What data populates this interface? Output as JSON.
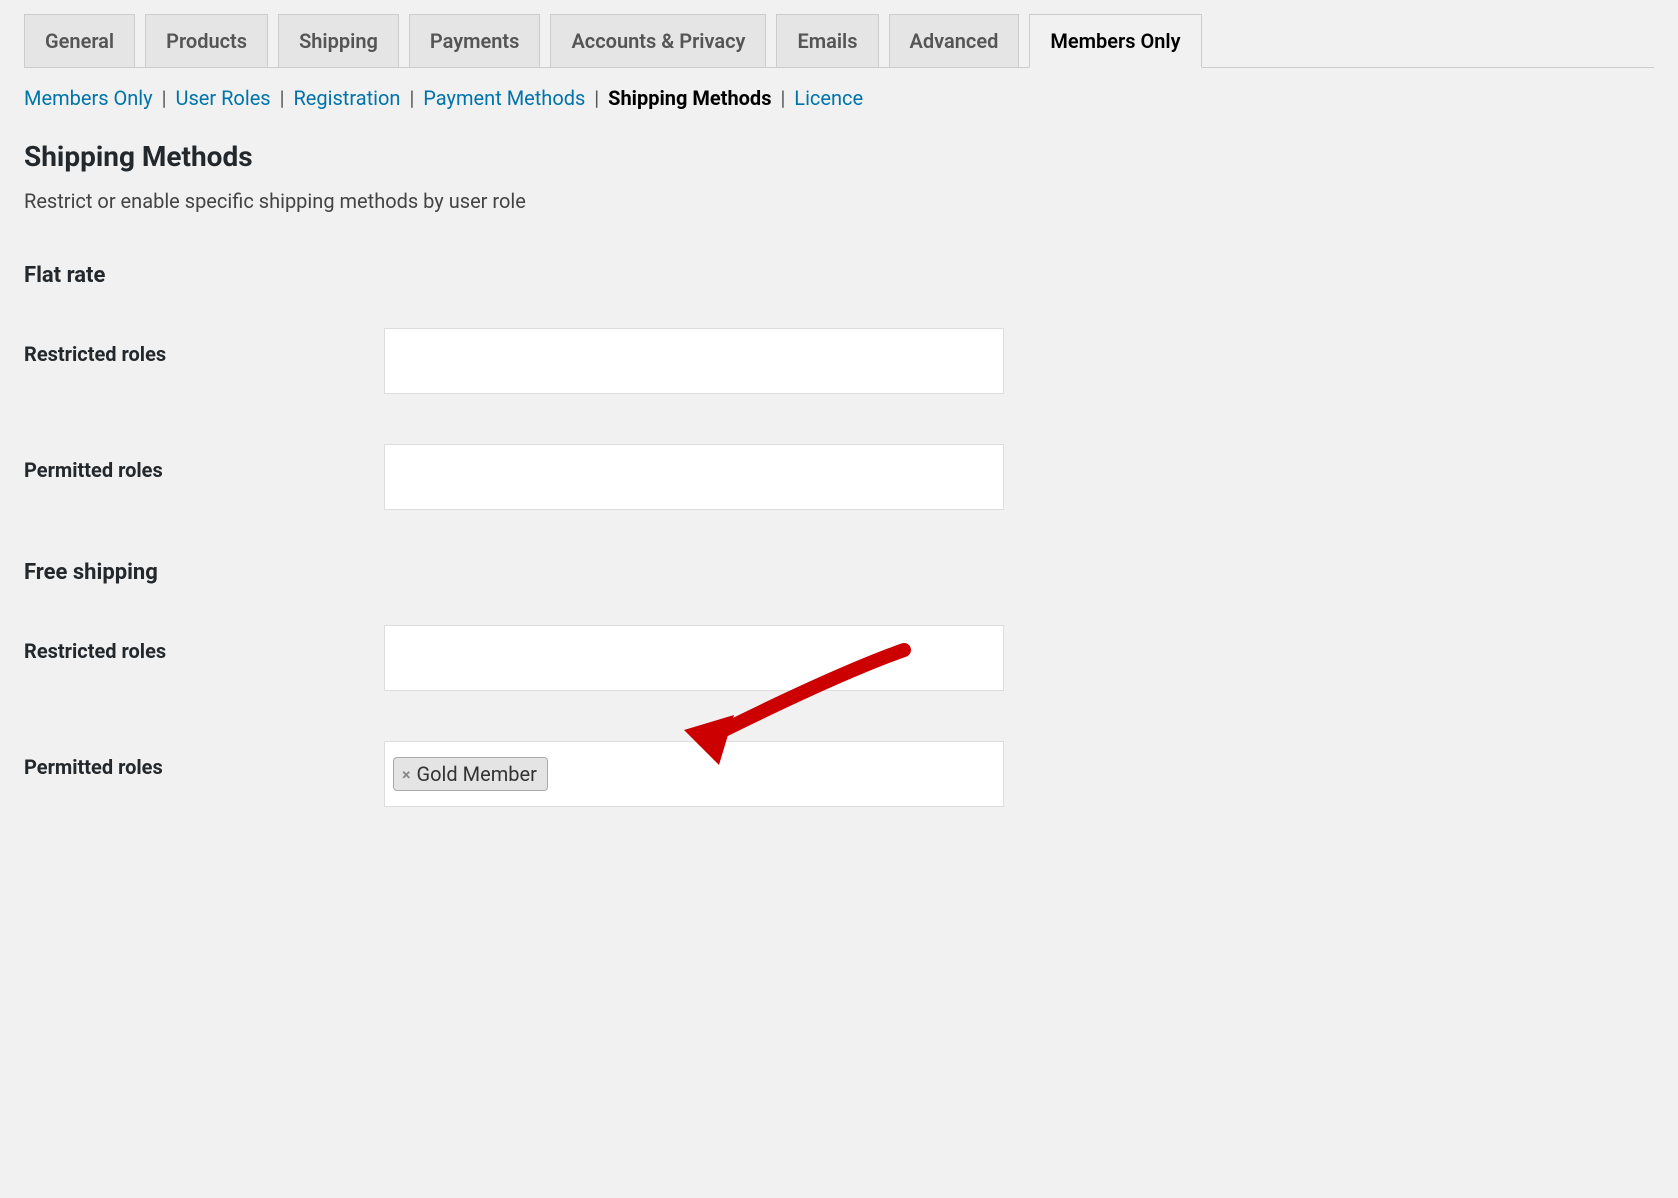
{
  "tabs": [
    {
      "label": "General",
      "active": false
    },
    {
      "label": "Products",
      "active": false
    },
    {
      "label": "Shipping",
      "active": false
    },
    {
      "label": "Payments",
      "active": false
    },
    {
      "label": "Accounts & Privacy",
      "active": false
    },
    {
      "label": "Emails",
      "active": false
    },
    {
      "label": "Advanced",
      "active": false
    },
    {
      "label": "Members Only",
      "active": true
    }
  ],
  "subnav": [
    {
      "label": "Members Only",
      "current": false
    },
    {
      "label": "User Roles",
      "current": false
    },
    {
      "label": "Registration",
      "current": false
    },
    {
      "label": "Payment Methods",
      "current": false
    },
    {
      "label": "Shipping Methods",
      "current": true
    },
    {
      "label": "Licence",
      "current": false
    }
  ],
  "section": {
    "title": "Shipping Methods",
    "description": "Restrict or enable specific shipping methods by user role"
  },
  "methods": [
    {
      "title": "Flat rate",
      "restricted_label": "Restricted roles",
      "restricted_values": [],
      "permitted_label": "Permitted roles",
      "permitted_values": []
    },
    {
      "title": "Free shipping",
      "restricted_label": "Restricted roles",
      "restricted_values": [],
      "permitted_label": "Permitted roles",
      "permitted_values": [
        "Gold Member"
      ]
    }
  ]
}
